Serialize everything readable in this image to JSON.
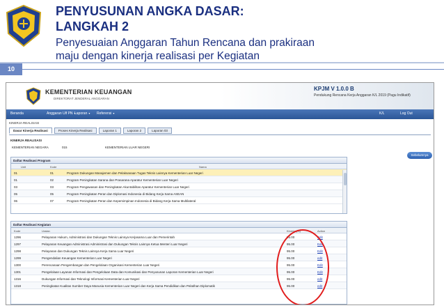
{
  "slide": {
    "title_line1": "PENYUSUNAN ANGKA DASAR:",
    "title_line2": "LANGKAH 2",
    "subtitle_line1": "Penyesuaian Anggaran Tahun Rencana dan prakiraan",
    "subtitle_line2": "maju dengan kinerja realisasi per Kegiatan",
    "page_number": "10",
    "colors": {
      "title": "#1a2f80",
      "accent": "#6b87c4",
      "highlight_ring": "#e11c1c"
    }
  },
  "app": {
    "ministry": "KEMENTERIAN KEUANGAN",
    "ministry_sub": "DIREKTORAT JENDERAL ANGGARAN",
    "version": "KPJM V 1.0.0 B",
    "description": "Pendukung Rencana Kerja Anggaran K/L 2019 (Pagu Indikatif)",
    "menu": [
      {
        "label": "Beranda",
        "has_caret": false
      },
      {
        "label": "Anggaran Ulf PN",
        "has_caret": true
      },
      {
        "label": "Laporan",
        "has_caret": true
      },
      {
        "label": "Referensi",
        "has_caret": true
      }
    ],
    "user": {
      "code": "K/L",
      "logout": "Log Out"
    },
    "breadcrumb": "KINERJA REALISASI",
    "tabs": [
      "Dasar Kinerja Realisasi",
      "Proses Kinerja Realisasi",
      "Laporan 1",
      "Laporan 2",
      "Laporan 03"
    ],
    "section_title": "KINERJA REALISASI",
    "field": {
      "label": "KEMENTERIAN NEGARA",
      "code": "015",
      "value": "KEMENTERIAN LUAR NEGERI"
    },
    "back_button": "Sebelumnya"
  },
  "program_grid": {
    "title": "Daftar Realisasi Program",
    "columns": [
      "Unit",
      "Kode",
      "Nama"
    ],
    "rows": [
      {
        "unit": "01",
        "kode": "01",
        "nama": "Program Dukungan Manajemen dan Pelaksanaan Tugas Teknis Lainnya Kementerian Luar Negeri",
        "selected": true
      },
      {
        "unit": "01",
        "kode": "02",
        "nama": "Program Peningkatan Sarana dan Prasarana Aparatur Kementerian Luar Negeri",
        "selected": false
      },
      {
        "unit": "03",
        "kode": "03",
        "nama": "Program Pengawasan dan Peningkatan Akuntabilitas Aparatur Kementerian Luar Negeri",
        "selected": false
      },
      {
        "unit": "05",
        "kode": "05",
        "nama": "Program Peningkatan Peran dan Diplomasi Indonesia di Bidang Kerja Sama ASEAN",
        "selected": false
      },
      {
        "unit": "06",
        "kode": "07",
        "nama": "Program Peningkatan Peran dan Kepemimpinan Indonesia di Bidang Kerja Sama Multilateral",
        "selected": false
      }
    ]
  },
  "kegiatan_grid": {
    "title": "Daftar Realisasi Kegiatan",
    "columns": [
      "Kode",
      "Uraian",
      "Kinerja (%)",
      "Action"
    ],
    "rows": [
      {
        "kode": "1296",
        "uraian": "Pelayanan Hukum, Administrasi dan Dukungan Teknis Lainnya Kerjasama Luar dan Pemerintah",
        "kinerja": "95.00",
        "action": "Edit"
      },
      {
        "kode": "1297",
        "uraian": "Pelayanan Keuangan Administrasi Administrasi dan Dukungan Teknis Lainnya Ketua Menteri Luar Negeri",
        "kinerja": "95.00",
        "action": "Edit"
      },
      {
        "kode": "1298",
        "uraian": "Pelayanan dan Dukungan Teknis Lainnya Kerja Sama Luar Negeri",
        "kinerja": "95.00",
        "action": "Edit"
      },
      {
        "kode": "1299",
        "uraian": "Pengendalian Keuangan Kementerian Luar Negeri",
        "kinerja": "95.00",
        "action": "edit"
      },
      {
        "kode": "1300",
        "uraian": "Perencanaan Pengembangan dan Pengelolaan Organisasi Kementerian Luar Negeri",
        "kinerja": "95.00",
        "action": "Edit"
      },
      {
        "kode": "1301",
        "uraian": "Pengelolaan Layanan Informasi dan Pengelolaan Data dan Komunikasi dan Penyusunan Laporan Kementerian Luar Negeri",
        "kinerja": "95.00",
        "action": "Edit"
      },
      {
        "kode": "1316",
        "uraian": "Dukungan Informasi dan Teknologi Informasi Kementerian Luar Negeri",
        "kinerja": "95.00",
        "action": "edit"
      },
      {
        "kode": "1318",
        "uraian": "Peningkatan Kualitas Sumber Daya Manusia Kementerian Luar Negeri dan Kerja Sama Pendidikan dan Pelatihan Diplomatik",
        "kinerja": "95.00",
        "action": "edit"
      }
    ]
  }
}
